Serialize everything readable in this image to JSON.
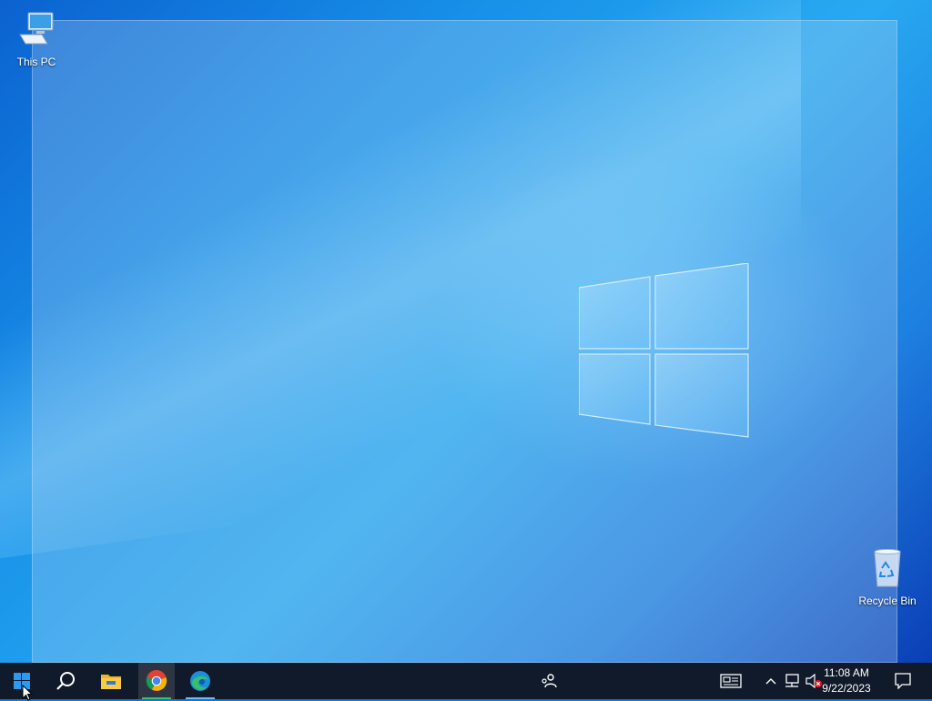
{
  "desktop": {
    "icons": [
      {
        "label": "This PC",
        "icon": "this-pc-icon"
      },
      {
        "label": "Recycle Bin",
        "icon": "recycle-bin-icon"
      }
    ]
  },
  "taskbar": {
    "buttons": [
      {
        "name": "start",
        "icon": "windows-start-icon"
      },
      {
        "name": "search",
        "icon": "search-icon"
      },
      {
        "name": "file-explorer",
        "icon": "folder-icon"
      },
      {
        "name": "chrome",
        "icon": "chrome-icon",
        "active": true
      },
      {
        "name": "edge",
        "icon": "edge-icon",
        "running": true
      }
    ],
    "people_icon": "people-icon",
    "tray": {
      "icons": [
        "news-icon",
        "chevron-up-icon",
        "network-icon",
        "volume-muted-icon"
      ],
      "time": "11:08 AM",
      "date": "9/22/2023",
      "notification_icon": "notification-icon"
    }
  },
  "colors": {
    "taskbar_bg": "#101a2a",
    "accent": "#76b9ed"
  }
}
